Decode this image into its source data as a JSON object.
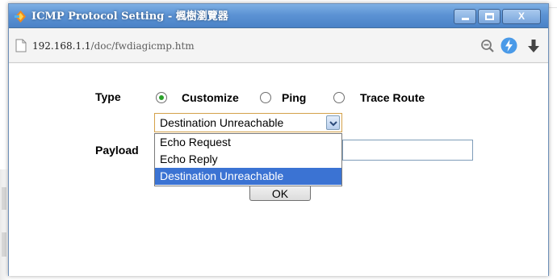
{
  "window": {
    "title": "ICMP Protocol Setting - 楓樹瀏覽器",
    "controls": {
      "close": "X"
    }
  },
  "address": {
    "host": "192.168.1.1",
    "path": "/doc/fwdiagicmp.htm"
  },
  "form": {
    "type_label": "Type",
    "type_options": [
      {
        "label": "Customize",
        "checked": true
      },
      {
        "label": "Ping",
        "checked": false
      },
      {
        "label": "Trace Route",
        "checked": false
      }
    ],
    "select": {
      "value": "Destination Unreachable",
      "options": [
        "Echo Request",
        "Echo Reply",
        "Destination Unreachable"
      ],
      "highlighted": "Destination Unreachable"
    },
    "payload_label": "Payload",
    "payload_value": "",
    "ok_label": "OK"
  },
  "colors": {
    "titlebar": "#5c93d4",
    "selection": "#3b73d3",
    "radio_checked": "#2aa12a",
    "select_border": "#d4a14a"
  },
  "icons": {
    "app": "maple-browser-icon",
    "page": "page-icon",
    "zoom": "zoom-out-icon",
    "speed": "lightning-icon",
    "download": "download-arrow-icon",
    "select_arrow": "chevron-down-icon"
  }
}
